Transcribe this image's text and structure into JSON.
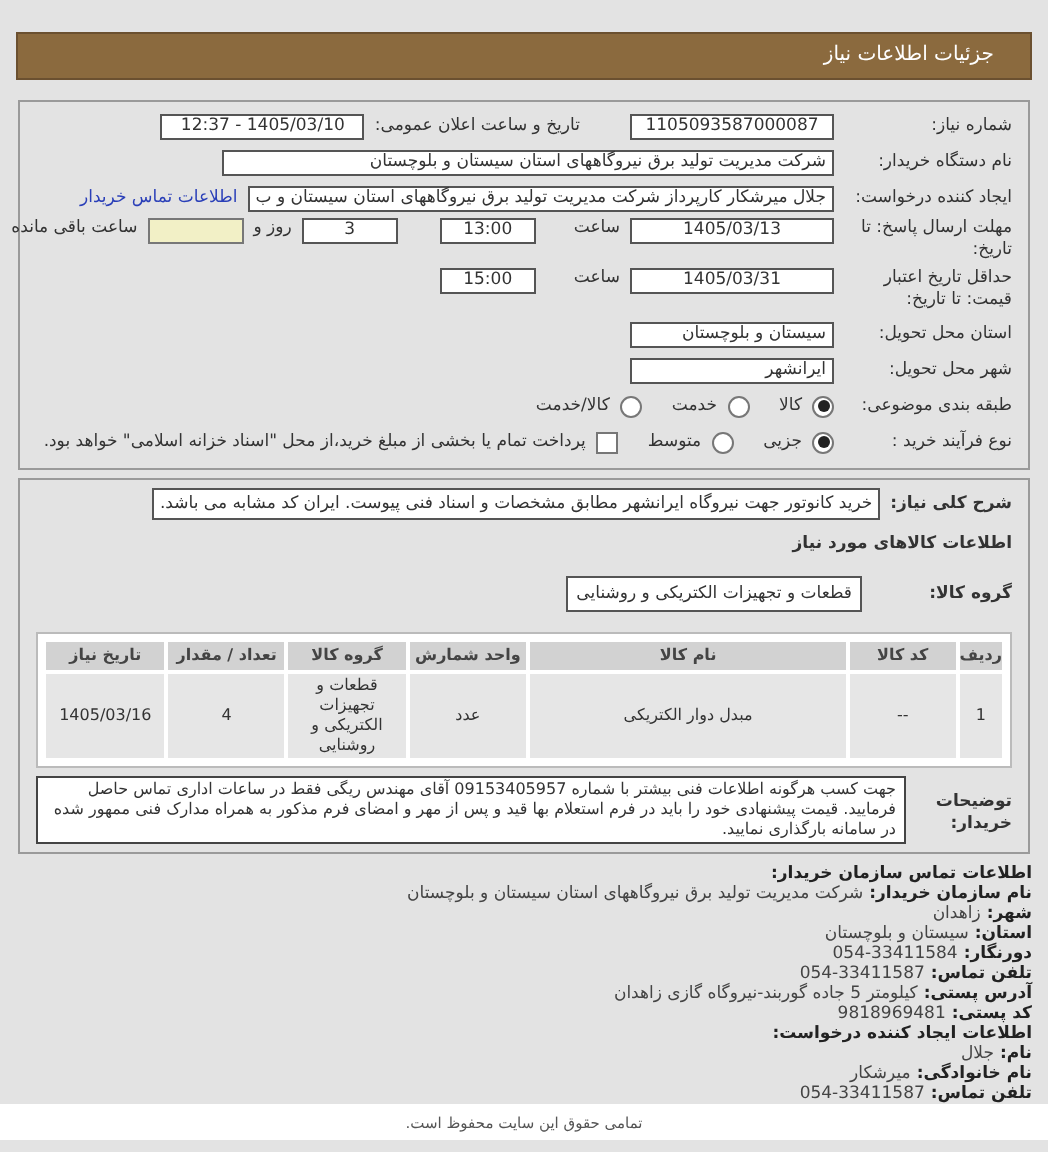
{
  "header": {
    "title": "جزئیات اطلاعات نیاز"
  },
  "form": {
    "need_number": {
      "label": "شماره نیاز:",
      "value": "1105093587000087"
    },
    "announce": {
      "label": "تاریخ و ساعت اعلان عمومی:",
      "value": "1405/03/10 - 12:37"
    },
    "buyer_org": {
      "label": "نام دستگاه خریدار:",
      "value": "شرکت مدیریت تولید برق نیروگاههای استان سیستان و بلوچستان"
    },
    "requester": {
      "label": "ایجاد کننده درخواست:",
      "value": "جلال میرشکار کارپرداز شرکت مدیریت تولید برق نیروگاههای استان سیستان و ب",
      "link": "اطلاعات تماس خریدار"
    },
    "deadline": {
      "label": "مهلت ارسال پاسخ: تا تاریخ:",
      "date": "1405/03/13",
      "time_label": "ساعت",
      "time": "13:00",
      "days": "3",
      "days_label": "روز و",
      "remaining_label": "ساعت باقی مانده"
    },
    "validity": {
      "label": "حداقل تاریخ اعتبار قیمت: تا تاریخ:",
      "date": "1405/03/31",
      "time_label": "ساعت",
      "time": "15:00"
    },
    "province": {
      "label": "استان محل تحویل:",
      "value": "سیستان و بلوچستان"
    },
    "city": {
      "label": "شهر محل تحویل:",
      "value": "ایرانشهر"
    },
    "category": {
      "label": "طبقه بندی موضوعی:",
      "options": [
        {
          "label": "کالا",
          "selected": true
        },
        {
          "label": "خدمت",
          "selected": false
        },
        {
          "label": "کالا/خدمت",
          "selected": false
        }
      ]
    },
    "process": {
      "label": "نوع فرآیند خرید :",
      "options": [
        {
          "label": "جزیی",
          "selected": true
        },
        {
          "label": "متوسط",
          "selected": false
        }
      ],
      "payment": {
        "label": "پرداخت تمام یا بخشی از مبلغ خرید،از محل \"اسناد خزانه اسلامی\" خواهد بود.",
        "checked": false
      }
    }
  },
  "details": {
    "description": {
      "label": "شرح کلی نیاز:",
      "value": "خرید کانوتور جهت نیروگاه ایرانشهر مطابق مشخصات و اسناد فنی پیوست. ایران کد مشابه می باشد."
    },
    "goods_heading": "اطلاعات کالاهای مورد نیاز",
    "goods_group": {
      "label": "گروه کالا:",
      "value": "قطعات و تجهیزات الکتریکی و روشنایی"
    },
    "table": {
      "columns": [
        "ردیف",
        "کد کالا",
        "نام کالا",
        "واحد شمارش",
        "گروه کالا",
        "تعداد / مقدار",
        "تاریخ نیاز"
      ],
      "rows": [
        [
          "1",
          "--",
          "مبدل دوار الکتریکی",
          "عدد",
          "قطعات و تجهیزات الکتریکی و روشنایی",
          "4",
          "1405/03/16"
        ]
      ]
    },
    "notes": {
      "label": "توضیحات خریدار:",
      "value": "جهت کسب هرگونه اطلاعات فنی بیشتر با شماره 09153405957 آقای مهندس ریگی فقط در ساعات اداری تماس حاصل فرمایید. قیمت پیشنهادی خود را باید در فرم استعلام بها قید و پس از مهر و امضای فرم مذکور به همراه مدارک فنی ممهور شده در سامانه بارگذاری نمایید."
    }
  },
  "contact": [
    {
      "kind": "heading",
      "label": "اطلاعات تماس سازمان خریدار:"
    },
    {
      "kind": "field",
      "label": "نام سازمان خریدار:",
      "value": "شرکت مدیریت تولید برق نیروگاههای استان سیستان و بلوچستان"
    },
    {
      "kind": "field",
      "label": "شهر:",
      "value": "زاهدان"
    },
    {
      "kind": "field",
      "label": "استان:",
      "value": "سیستان و بلوچستان"
    },
    {
      "kind": "field",
      "label": "دورنگار:",
      "value": "054-33411584"
    },
    {
      "kind": "field",
      "label": "تلفن تماس:",
      "value": "054-33411587"
    },
    {
      "kind": "field",
      "label": "آدرس پستی:",
      "value": "کیلومتر 5 جاده گوربند-نیروگاه گازی زاهدان"
    },
    {
      "kind": "field",
      "label": "کد پستی:",
      "value": "9818969481"
    },
    {
      "kind": "heading",
      "label": "اطلاعات ایجاد کننده درخواست:"
    },
    {
      "kind": "field",
      "label": "نام:",
      "value": "جلال"
    },
    {
      "kind": "field",
      "label": "نام خانوادگی:",
      "value": "میرشکار"
    },
    {
      "kind": "field",
      "label": "تلفن تماس:",
      "value": "054-33411587"
    }
  ],
  "footer": {
    "text": "تمامی حقوق این سایت محفوظ است."
  }
}
